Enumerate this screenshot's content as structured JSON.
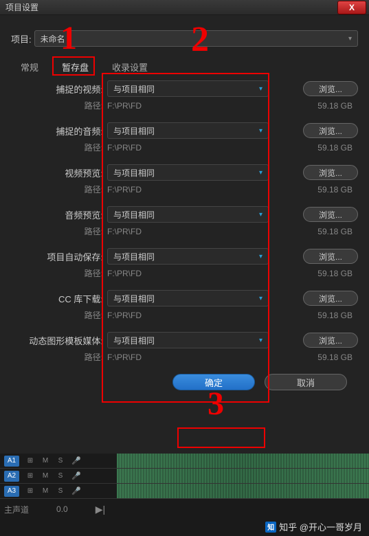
{
  "titlebar": {
    "title": "项目设置",
    "close": "X"
  },
  "project": {
    "label": "项目:",
    "name": "未命名"
  },
  "tabs": {
    "general": "常规",
    "scratch": "暂存盘",
    "ingest": "收录设置"
  },
  "rows": [
    {
      "label": "捕捉的视频:",
      "value": "与项目相同",
      "browse": "浏览...",
      "pathLabel": "路径:",
      "path": "F:\\PR\\FD",
      "size": "59.18 GB"
    },
    {
      "label": "捕捉的音频:",
      "value": "与项目相同",
      "browse": "浏览...",
      "pathLabel": "路径:",
      "path": "F:\\PR\\FD",
      "size": "59.18 GB"
    },
    {
      "label": "视频预览:",
      "value": "与项目相同",
      "browse": "浏览...",
      "pathLabel": "路径:",
      "path": "F:\\PR\\FD",
      "size": "59.18 GB"
    },
    {
      "label": "音频预览:",
      "value": "与项目相同",
      "browse": "浏览...",
      "pathLabel": "路径:",
      "path": "F:\\PR\\FD",
      "size": "59.18 GB"
    },
    {
      "label": "项目自动保存:",
      "value": "与项目相同",
      "browse": "浏览...",
      "pathLabel": "路径:",
      "path": "F:\\PR\\FD",
      "size": "59.18 GB"
    },
    {
      "label": "CC 库下载:",
      "value": "与项目相同",
      "browse": "浏览...",
      "pathLabel": "路径:",
      "path": "F:\\PR\\FD",
      "size": "59.18 GB"
    },
    {
      "label": "动态图形模板媒体:",
      "value": "与项目相同",
      "browse": "浏览...",
      "pathLabel": "路径:",
      "path": "F:\\PR\\FD",
      "size": "59.18 GB"
    }
  ],
  "footer": {
    "ok": "确定",
    "cancel": "取消"
  },
  "tracks": [
    {
      "name": "A1",
      "m": "M",
      "s": "S"
    },
    {
      "name": "A2",
      "m": "M",
      "s": "S"
    },
    {
      "name": "A3",
      "m": "M",
      "s": "S"
    }
  ],
  "master": {
    "label": "主声道",
    "val": "0.0"
  },
  "watermark": "知乎 @开心一哥岁月",
  "anno": {
    "n1": "1",
    "n2": "2",
    "n3": "3"
  }
}
